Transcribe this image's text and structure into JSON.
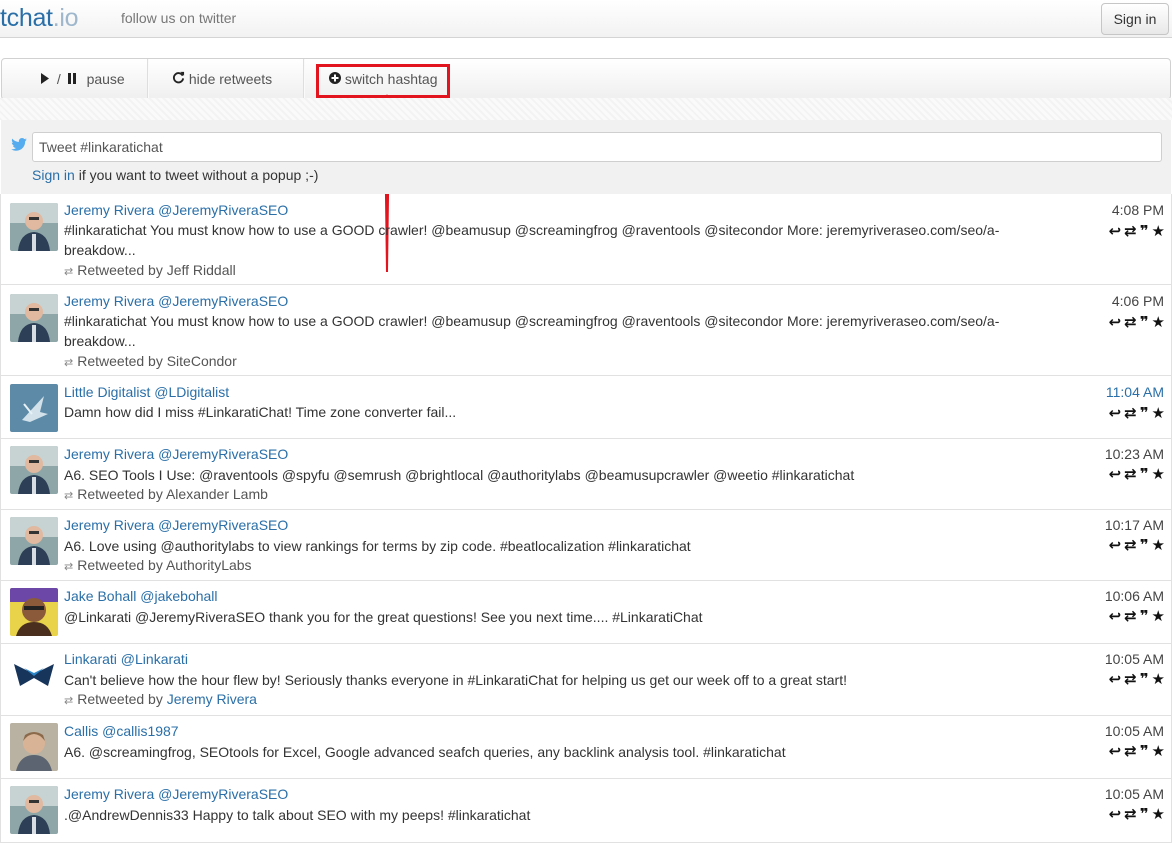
{
  "header": {
    "brand_main": "tchat",
    "brand_suffix": ".io",
    "follow_link": "follow us on twitter",
    "signin_button": "Sign in"
  },
  "toolbar": {
    "play_pause_sep": "/",
    "pause_label": "pause",
    "hide_retweets_label": "hide retweets",
    "switch_hashtag_label": "switch hashtag"
  },
  "compose": {
    "placeholder": "Tweet #linkaratichat",
    "signin_link": "Sign in",
    "signin_note": " if you want to tweet without a popup ;-)"
  },
  "colors": {
    "link": "#2a6fa8",
    "highlight_annotation": "#e2141d"
  },
  "tweets": [
    {
      "author": "Jeremy Rivera @JeremyRiveraSEO",
      "time": "4:08 PM",
      "text_line1": "#linkaratichat You must know how to use a GOOD crawler! @beamusup @screamingfrog @raventools @sitecondor More: jeremyriveraseo.com/seo/a-",
      "text_line2": "breakdow...",
      "retweeted_by_label": "Retweeted by",
      "retweeted_by": "Jeff Riddall"
    },
    {
      "author": "Jeremy Rivera @JeremyRiveraSEO",
      "time": "4:06 PM",
      "text_line1": "#linkaratichat You must know how to use a GOOD crawler! @beamusup @screamingfrog @raventools @sitecondor More: jeremyriveraseo.com/seo/a-",
      "text_line2": "breakdow...",
      "retweeted_by_label": "Retweeted by",
      "retweeted_by": "SiteCondor"
    },
    {
      "author": "Little Digitalist @LDigitalist",
      "time": "11:04 AM",
      "text_line1": "Damn how did I miss #LinkaratiChat! Time zone converter fail..."
    },
    {
      "author": "Jeremy Rivera @JeremyRiveraSEO",
      "time": "10:23 AM",
      "text_line1": "A6. SEO Tools I Use: @raventools @spyfu @semrush @brightlocal @authoritylabs @beamusupcrawler @weetio #linkaratichat",
      "retweeted_by_label": "Retweeted by",
      "retweeted_by": "Alexander Lamb"
    },
    {
      "author": "Jeremy Rivera @JeremyRiveraSEO",
      "time": "10:17 AM",
      "text_line1": "A6. Love using @authoritylabs to view rankings for terms by zip code. #beatlocalization #linkaratichat",
      "retweeted_by_label": "Retweeted by",
      "retweeted_by": "AuthorityLabs"
    },
    {
      "author": "Jake Bohall @jakebohall",
      "time": "10:06 AM",
      "text_line1": "@Linkarati @JeremyRiveraSEO thank you for the great questions! See you next time.... #LinkaratiChat"
    },
    {
      "author": "Linkarati @Linkarati",
      "time": "10:05 AM",
      "text_line1": "Can't believe how the hour flew by! Seriously thanks everyone in #LinkaratiChat for helping us get our week off to a great start!",
      "retweeted_by_label": "Retweeted by",
      "retweeted_by": "Jeremy Rivera"
    },
    {
      "author": "Callis @callis1987",
      "time": "10:05 AM",
      "text_line1": "A6. @screamingfrog, SEOtools for Excel, Google advanced seafch queries, any backlink analysis tool. #linkaratichat"
    },
    {
      "author": "Jeremy Rivera @JeremyRiveraSEO",
      "time": "10:05 AM",
      "text_line1": ".@AndrewDennis33 Happy to talk about SEO with my peeps! #linkaratichat"
    }
  ]
}
